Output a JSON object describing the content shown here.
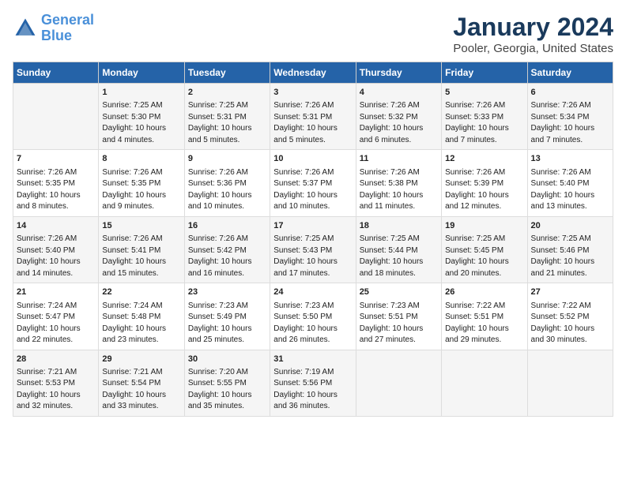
{
  "header": {
    "logo_general": "General",
    "logo_blue": "Blue",
    "title": "January 2024",
    "subtitle": "Pooler, Georgia, United States"
  },
  "calendar": {
    "weekdays": [
      "Sunday",
      "Monday",
      "Tuesday",
      "Wednesday",
      "Thursday",
      "Friday",
      "Saturday"
    ],
    "rows": [
      [
        {
          "day": "",
          "info": ""
        },
        {
          "day": "1",
          "info": "Sunrise: 7:25 AM\nSunset: 5:30 PM\nDaylight: 10 hours\nand 4 minutes."
        },
        {
          "day": "2",
          "info": "Sunrise: 7:25 AM\nSunset: 5:31 PM\nDaylight: 10 hours\nand 5 minutes."
        },
        {
          "day": "3",
          "info": "Sunrise: 7:26 AM\nSunset: 5:31 PM\nDaylight: 10 hours\nand 5 minutes."
        },
        {
          "day": "4",
          "info": "Sunrise: 7:26 AM\nSunset: 5:32 PM\nDaylight: 10 hours\nand 6 minutes."
        },
        {
          "day": "5",
          "info": "Sunrise: 7:26 AM\nSunset: 5:33 PM\nDaylight: 10 hours\nand 7 minutes."
        },
        {
          "day": "6",
          "info": "Sunrise: 7:26 AM\nSunset: 5:34 PM\nDaylight: 10 hours\nand 7 minutes."
        }
      ],
      [
        {
          "day": "7",
          "info": "Sunrise: 7:26 AM\nSunset: 5:35 PM\nDaylight: 10 hours\nand 8 minutes."
        },
        {
          "day": "8",
          "info": "Sunrise: 7:26 AM\nSunset: 5:35 PM\nDaylight: 10 hours\nand 9 minutes."
        },
        {
          "day": "9",
          "info": "Sunrise: 7:26 AM\nSunset: 5:36 PM\nDaylight: 10 hours\nand 10 minutes."
        },
        {
          "day": "10",
          "info": "Sunrise: 7:26 AM\nSunset: 5:37 PM\nDaylight: 10 hours\nand 10 minutes."
        },
        {
          "day": "11",
          "info": "Sunrise: 7:26 AM\nSunset: 5:38 PM\nDaylight: 10 hours\nand 11 minutes."
        },
        {
          "day": "12",
          "info": "Sunrise: 7:26 AM\nSunset: 5:39 PM\nDaylight: 10 hours\nand 12 minutes."
        },
        {
          "day": "13",
          "info": "Sunrise: 7:26 AM\nSunset: 5:40 PM\nDaylight: 10 hours\nand 13 minutes."
        }
      ],
      [
        {
          "day": "14",
          "info": "Sunrise: 7:26 AM\nSunset: 5:40 PM\nDaylight: 10 hours\nand 14 minutes."
        },
        {
          "day": "15",
          "info": "Sunrise: 7:26 AM\nSunset: 5:41 PM\nDaylight: 10 hours\nand 15 minutes."
        },
        {
          "day": "16",
          "info": "Sunrise: 7:26 AM\nSunset: 5:42 PM\nDaylight: 10 hours\nand 16 minutes."
        },
        {
          "day": "17",
          "info": "Sunrise: 7:25 AM\nSunset: 5:43 PM\nDaylight: 10 hours\nand 17 minutes."
        },
        {
          "day": "18",
          "info": "Sunrise: 7:25 AM\nSunset: 5:44 PM\nDaylight: 10 hours\nand 18 minutes."
        },
        {
          "day": "19",
          "info": "Sunrise: 7:25 AM\nSunset: 5:45 PM\nDaylight: 10 hours\nand 20 minutes."
        },
        {
          "day": "20",
          "info": "Sunrise: 7:25 AM\nSunset: 5:46 PM\nDaylight: 10 hours\nand 21 minutes."
        }
      ],
      [
        {
          "day": "21",
          "info": "Sunrise: 7:24 AM\nSunset: 5:47 PM\nDaylight: 10 hours\nand 22 minutes."
        },
        {
          "day": "22",
          "info": "Sunrise: 7:24 AM\nSunset: 5:48 PM\nDaylight: 10 hours\nand 23 minutes."
        },
        {
          "day": "23",
          "info": "Sunrise: 7:23 AM\nSunset: 5:49 PM\nDaylight: 10 hours\nand 25 minutes."
        },
        {
          "day": "24",
          "info": "Sunrise: 7:23 AM\nSunset: 5:50 PM\nDaylight: 10 hours\nand 26 minutes."
        },
        {
          "day": "25",
          "info": "Sunrise: 7:23 AM\nSunset: 5:51 PM\nDaylight: 10 hours\nand 27 minutes."
        },
        {
          "day": "26",
          "info": "Sunrise: 7:22 AM\nSunset: 5:51 PM\nDaylight: 10 hours\nand 29 minutes."
        },
        {
          "day": "27",
          "info": "Sunrise: 7:22 AM\nSunset: 5:52 PM\nDaylight: 10 hours\nand 30 minutes."
        }
      ],
      [
        {
          "day": "28",
          "info": "Sunrise: 7:21 AM\nSunset: 5:53 PM\nDaylight: 10 hours\nand 32 minutes."
        },
        {
          "day": "29",
          "info": "Sunrise: 7:21 AM\nSunset: 5:54 PM\nDaylight: 10 hours\nand 33 minutes."
        },
        {
          "day": "30",
          "info": "Sunrise: 7:20 AM\nSunset: 5:55 PM\nDaylight: 10 hours\nand 35 minutes."
        },
        {
          "day": "31",
          "info": "Sunrise: 7:19 AM\nSunset: 5:56 PM\nDaylight: 10 hours\nand 36 minutes."
        },
        {
          "day": "",
          "info": ""
        },
        {
          "day": "",
          "info": ""
        },
        {
          "day": "",
          "info": ""
        }
      ]
    ]
  }
}
